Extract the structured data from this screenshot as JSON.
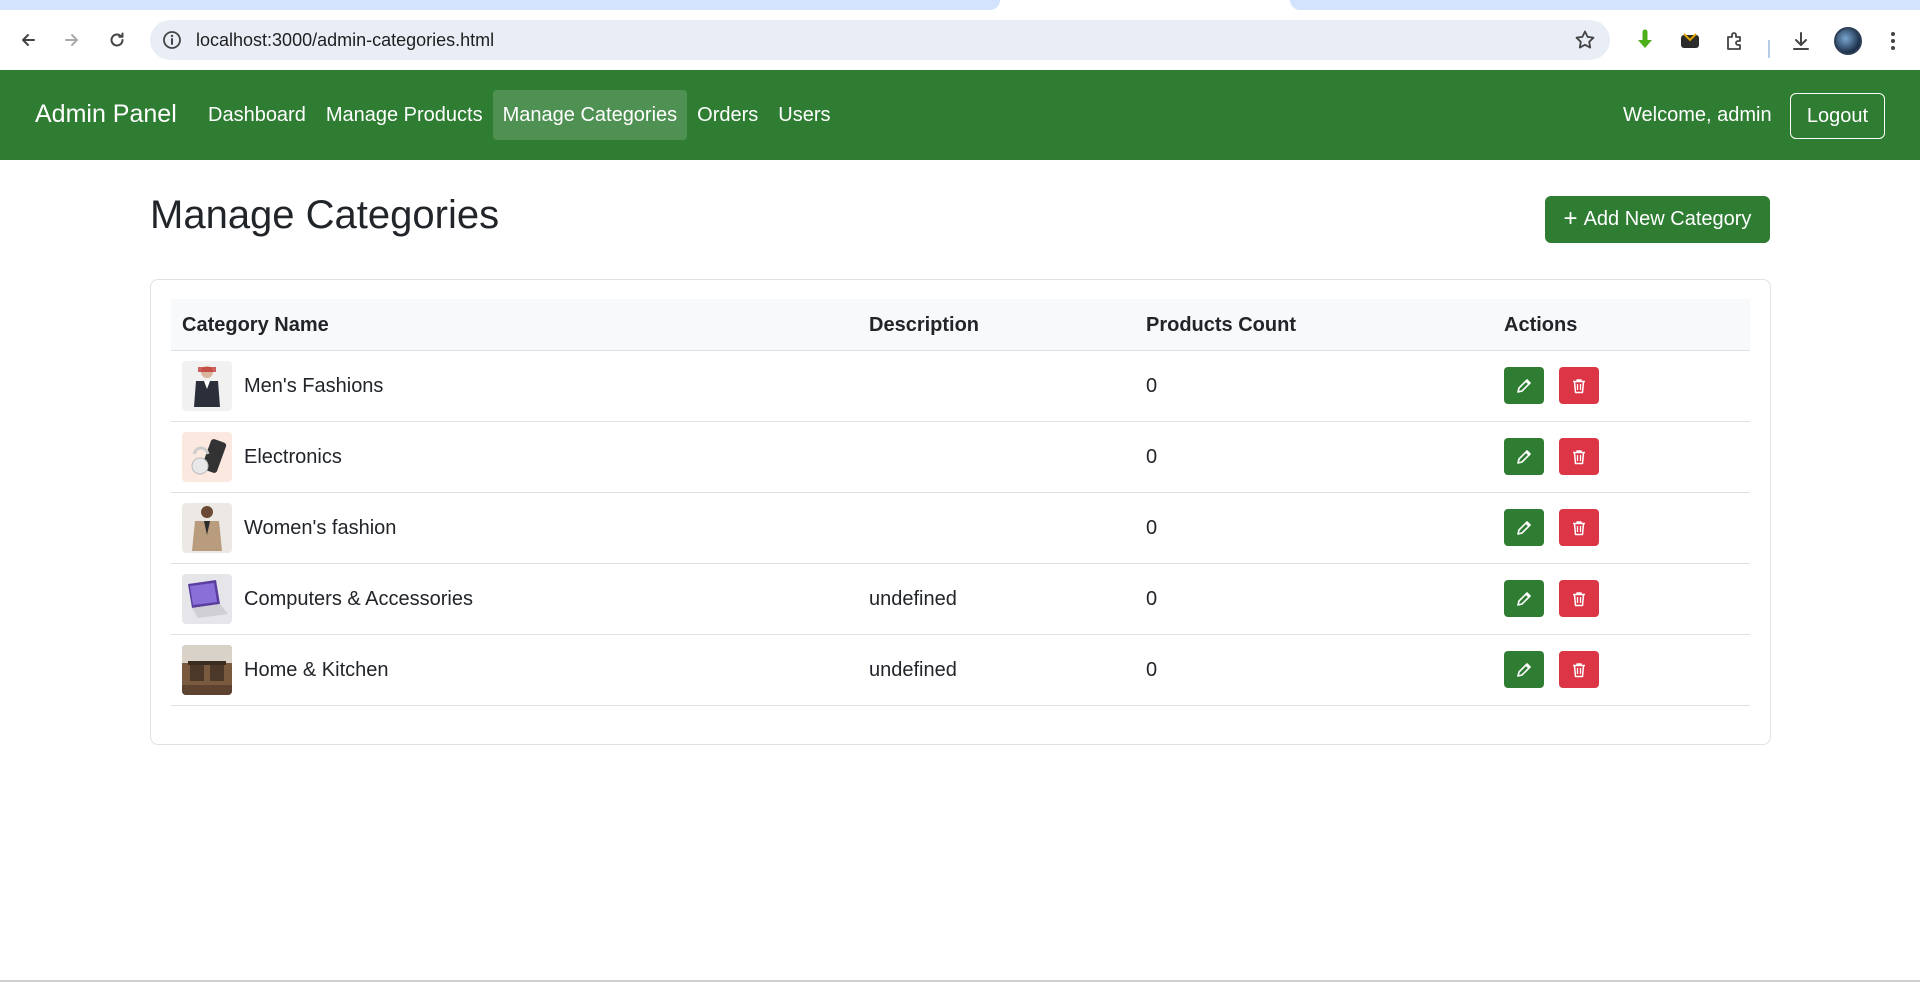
{
  "browser": {
    "url": "localhost:3000/admin-categories.html"
  },
  "navbar": {
    "brand": "Admin Panel",
    "links": [
      {
        "label": "Dashboard",
        "active": false
      },
      {
        "label": "Manage Products",
        "active": false
      },
      {
        "label": "Manage Categories",
        "active": true
      },
      {
        "label": "Orders",
        "active": false
      },
      {
        "label": "Users",
        "active": false
      }
    ],
    "welcome": "Welcome, admin",
    "logout_label": "Logout",
    "color": "#2e7d32"
  },
  "page": {
    "title": "Manage Categories",
    "add_button_label": "Add New Category",
    "add_button_icon": "plus-icon"
  },
  "table": {
    "headers": {
      "name": "Category Name",
      "description": "Description",
      "count": "Products Count",
      "actions": "Actions"
    },
    "rows": [
      {
        "name": "Men's Fashions",
        "description": "",
        "count": "0",
        "image": "mens-fashion-thumbnail"
      },
      {
        "name": "Electronics",
        "description": "",
        "count": "0",
        "image": "electronics-thumbnail"
      },
      {
        "name": "Women's fashion",
        "description": "",
        "count": "0",
        "image": "womens-fashion-thumbnail"
      },
      {
        "name": "Computers & Accessories",
        "description": "undefined",
        "count": "0",
        "image": "laptop-thumbnail"
      },
      {
        "name": "Home & Kitchen",
        "description": "undefined",
        "count": "0",
        "image": "home-kitchen-thumbnail"
      }
    ],
    "edit_icon": "pencil-icon",
    "delete_icon": "trash-icon",
    "edit_color": "#2e7d32",
    "delete_color": "#dc3545"
  }
}
